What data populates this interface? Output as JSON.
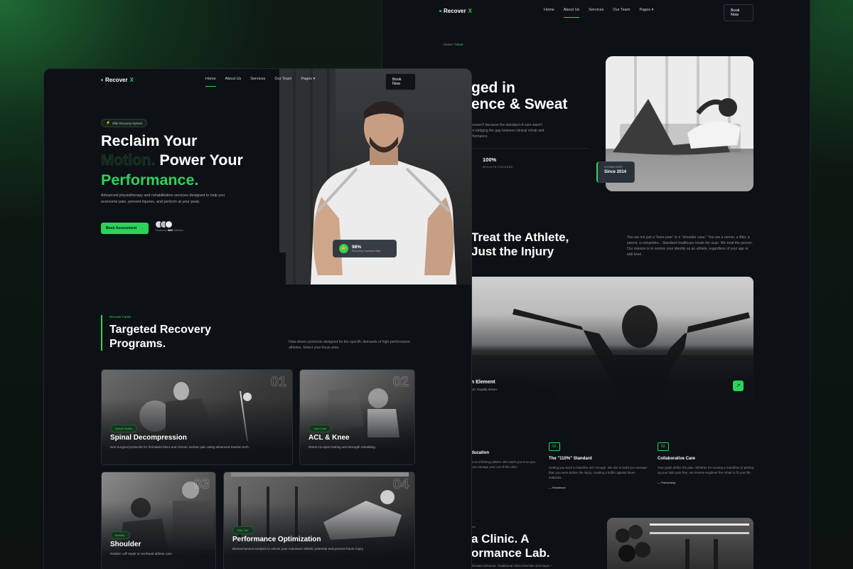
{
  "colors": {
    "accent": "#2bd35b",
    "bg": "#0d1015"
  },
  "back": {
    "logo": {
      "name": "Recover",
      "mark": "X"
    },
    "nav": [
      "Home",
      "About Us",
      "Services",
      "Our Team",
      "Pages"
    ],
    "cta": "Book Now",
    "breadcrumb": {
      "home": "Home",
      "sep": "/",
      "current": "About"
    },
    "hero": {
      "line1": "ged in",
      "line2": "ence & Sweat",
      "desc1": "ecoverX because the standard of care wasn't",
      "desc2": "re bridging the gap between clinical rehab and",
      "desc3": "rformance."
    },
    "stat": {
      "value": "100%",
      "label": "ATHLETE FOCUSED"
    },
    "established": {
      "label": "ESTABLISHED",
      "value": "Since 2014"
    },
    "section2": {
      "line1": "Treat the Athlete,",
      "line2": "Just the Injury",
      "desc": "You are not just a \"knee pain\" or a \"shoulder case.\" You are a runner, a lifter, a parent, a competitor... Standard healthcare treats the scan. We treat the person. Our mission is to restore your identity as an athlete, regardless of your age or skill level."
    },
    "banner": {
      "title": "n Element",
      "sub": "ion. Equally driven."
    },
    "values": [
      {
        "num": "",
        "title": "ducation",
        "desc": "ts to a lifelong pattern. We teach you ts so you can manage your out of the clinic.",
        "sig": ""
      },
      {
        "num": "02",
        "title": "The \"110%\" Standard",
        "desc": "Getting you back to baseline isn't enough. We aim to build you stronger than you were before the injury, creating a buffer against future setbacks.",
        "sig": "— Resilience"
      },
      {
        "num": "03",
        "title": "Collaborative Care",
        "desc": "Your goals define the plan. Whether it's running a marathon or picking up your kids pain-free, we reverse-engineer the rehab to fit your life.",
        "sig": "— Partnership"
      }
    ],
    "bottom": {
      "kicker": "ent",
      "line1": "a Clinic. A",
      "line2": "ormance Lab.",
      "desc": "dictates behavior. Traditional clinics feel like sick bays—"
    }
  },
  "front": {
    "logo": {
      "name": "Recover",
      "mark": "X"
    },
    "nav": [
      "Home",
      "About Us",
      "Services",
      "Our Team",
      "Pages"
    ],
    "cta": "Book Now",
    "badge": "Elite Recovery System",
    "hero": {
      "l1": "Reclaim Your",
      "l2a": "Motion.",
      "l2b": " Power Your",
      "l3": "Performance."
    },
    "desc": "Advanced physiotherapy and rehabilitation services designed to help you overcome pain, prevent injuries, and perform at your peak.",
    "hero_cta": "Book Assessment",
    "trusted": {
      "pre": "Trusted by",
      "count": "500+",
      "post": "Athletes"
    },
    "success": {
      "value": "98%",
      "label": "Recovery Success Rate"
    },
    "programs": {
      "kicker": "Recover Faster",
      "title1": "Targeted Recovery",
      "title2": "Programs.",
      "desc": "Data-driven protocols designed for the specific demands of high-performance athletes. Select your focus area."
    },
    "cards": [
      {
        "num": "01",
        "tag": "Spinal Health",
        "title": "Spinal Decompression",
        "desc": "Non-surgical protocols for herniated discs and chronic lumbar pain using advanced traction tech."
      },
      {
        "num": "02",
        "tag": "Joint Care",
        "title": "ACL & Knee",
        "desc": "Return-to-sport testing and strength rebuilding."
      },
      {
        "num": "03",
        "tag": "Mobility",
        "title": "Shoulder",
        "desc": "Rotator cuff repair & overhead athlete care."
      },
      {
        "num": "04",
        "tag": "Elite Tier",
        "title": "Performance Optimization",
        "desc": "Biomechanical analysis to unlock your maximum athletic potential and prevent future injury."
      }
    ]
  }
}
